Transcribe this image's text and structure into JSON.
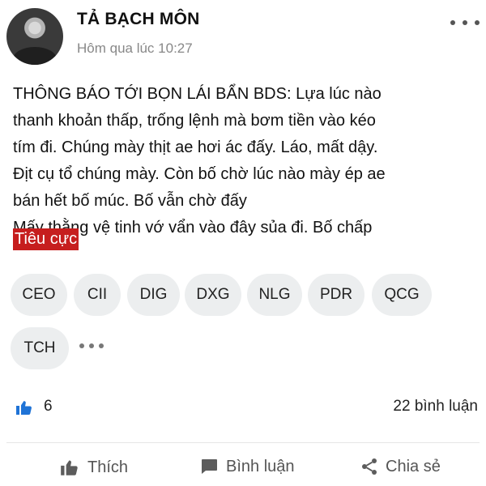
{
  "author": {
    "name": "TẢ BẠCH MÔN",
    "time": "Hôm qua lúc 10:27"
  },
  "post": {
    "text": "THÔNG BÁO TỚI BỌN LÁI BẨN BDS: Lựa lúc nào\nthanh khoản thấp, trống lệnh mà bơm tiền vào kéo\ntím đi. Chúng mày thịt ae hơi ác đấy. Láo, mất dậy.\nĐịt cụ tổ chúng mày. Còn bố chờ lúc nào mày ép ae\nbán hết bố múc. Bố vẫn chờ đấy\nMấy thằng vệ tinh vớ vẩn vào đây sủa đi. Bố chấp",
    "sentiment": "Tiêu cực"
  },
  "tags": [
    "CEO",
    "CII",
    "DIG",
    "DXG",
    "NLG",
    "PDR",
    "QCG",
    "TCH"
  ],
  "stats": {
    "likes": "6",
    "comments": "22 bình luận"
  },
  "actions": {
    "like": "Thích",
    "comment": "Bình luận",
    "share": "Chia sẻ"
  },
  "colors": {
    "like_blue": "#1f73d6",
    "sentiment_red": "#c61e1e",
    "chip_bg": "#eceeef"
  },
  "icons": [
    "more-icon",
    "like-icon",
    "thumb-up-icon",
    "comment-icon",
    "share-icon"
  ]
}
